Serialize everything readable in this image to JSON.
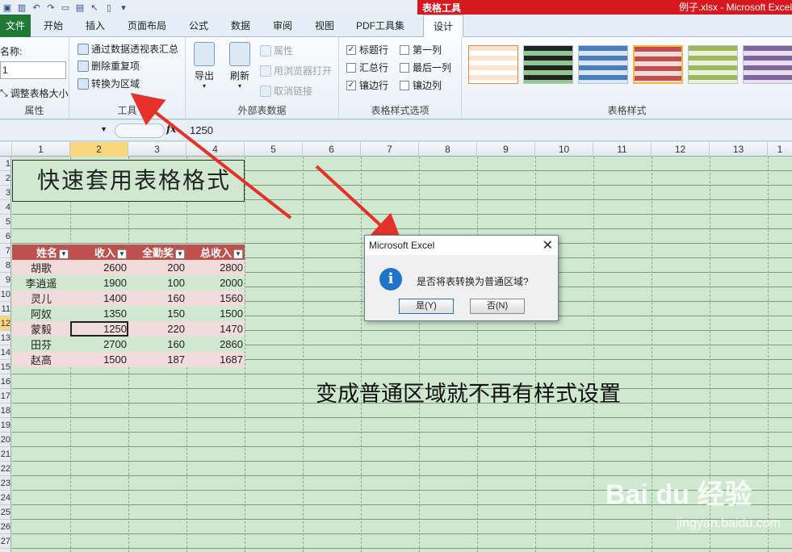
{
  "titlebar": {
    "context_tab": "表格工具",
    "window_title": "例子.xlsx - Microsoft Excel"
  },
  "tabs": [
    "文件",
    "开始",
    "插入",
    "页面布局",
    "公式",
    "数据",
    "审阅",
    "视图",
    "PDF工具集",
    "设计"
  ],
  "ribbon": {
    "properties": {
      "name_label": "名称:",
      "name_value": "1",
      "resize_button": "调整表格大小",
      "group_label": "属性"
    },
    "tools": {
      "pivot_button": "通过数据透视表汇总",
      "remove_dup_button": "删除重复项",
      "convert_button": "转换为区域",
      "group_label": "工具"
    },
    "external": {
      "export_button": "导出",
      "refresh_button": "刷新",
      "properties_button": "属性",
      "browser_button": "用浏览器打开",
      "unlink_button": "取消链接",
      "group_label": "外部表数据"
    },
    "style_options": {
      "header_row": "标题行",
      "total_row": "汇总行",
      "banded_rows": "镶边行",
      "first_column": "第一列",
      "last_column": "最后一列",
      "banded_columns": "镶边列",
      "group_label": "表格样式选项"
    },
    "table_styles": {
      "group_label": "表格样式"
    }
  },
  "formula_bar": {
    "fx": "fx",
    "value": "1250"
  },
  "grid": {
    "columns": [
      "1",
      "2",
      "3",
      "4",
      "5",
      "6",
      "7",
      "8",
      "9",
      "10",
      "11",
      "12",
      "13",
      "1"
    ],
    "rows": [
      "1",
      "2",
      "3",
      "4",
      "5",
      "6",
      "7",
      "8",
      "9",
      "10",
      "11",
      "12",
      "13",
      "14",
      "15",
      "16",
      "17",
      "18",
      "19",
      "20",
      "21",
      "22",
      "23",
      "24",
      "25",
      "26",
      "27"
    ]
  },
  "sheet": {
    "title": "快速套用表格格式",
    "headers": [
      "姓名",
      "收入",
      "全勤奖",
      "总收入"
    ],
    "rows": [
      [
        "胡歌",
        "2600",
        "200",
        "2800"
      ],
      [
        "李逍遥",
        "1900",
        "100",
        "2000"
      ],
      [
        "灵儿",
        "1400",
        "160",
        "1560"
      ],
      [
        "阿奴",
        "1350",
        "150",
        "1500"
      ],
      [
        "蒙毅",
        "1250",
        "220",
        "1470"
      ],
      [
        "田芬",
        "2700",
        "160",
        "2860"
      ],
      [
        "赵高",
        "1500",
        "187",
        "1687"
      ]
    ],
    "annotation": "变成普通区域就不再有样式设置"
  },
  "dialog": {
    "title": "Microsoft Excel",
    "message": "是否将表转换为普通区域?",
    "yes_button": "是(Y)",
    "no_button": "否(N)",
    "icon": "i"
  },
  "watermark": {
    "main": "Bai du 经验",
    "sub": "jingyan.baidu.com"
  },
  "colors": {
    "accent": "#d8181f",
    "header_fill": "#c0504d",
    "band_fill": "#f2dcdb",
    "sheet_bg": "#cfe8cf",
    "file_tab": "#1f7a35"
  }
}
